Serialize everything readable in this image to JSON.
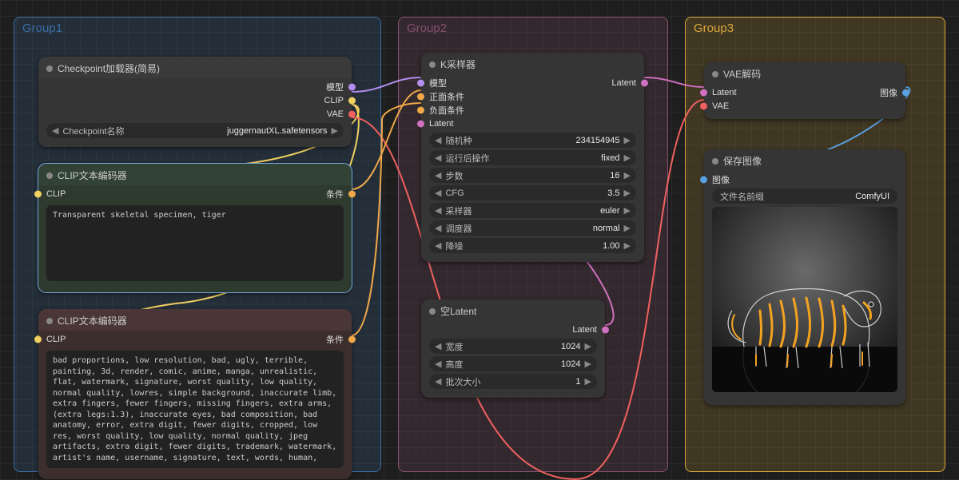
{
  "groups": {
    "g1": "Group1",
    "g2": "Group2",
    "g3": "Group3"
  },
  "checkpoint": {
    "title": "Checkpoint加载器(简易)",
    "out_model": "模型",
    "out_clip": "CLIP",
    "out_vae": "VAE",
    "widget_name": "Checkpoint名称",
    "widget_val": "juggernautXL.safetensors"
  },
  "pos": {
    "title": "CLIP文本编码器",
    "in_clip": "CLIP",
    "out_cond": "条件",
    "text": "Transparent skeletal specimen, tiger"
  },
  "neg": {
    "title": "CLIP文本编码器",
    "in_clip": "CLIP",
    "out_cond": "条件",
    "text": "bad proportions, low resolution, bad, ugly, terrible, painting, 3d, render, comic, anime, manga, unrealistic, flat, watermark, signature, worst quality, low quality, normal quality, lowres, simple background, inaccurate limb, extra fingers, fewer fingers, missing fingers, extra arms, (extra legs:1.3), inaccurate eyes, bad composition, bad anatomy, error, extra digit, fewer digits, cropped, low res, worst quality, low quality, normal quality, jpeg artifacts, extra digit, fewer digits, trademark, watermark, artist's name, username, signature, text, words, human,"
  },
  "ksampler": {
    "title": "K采样器",
    "in_model": "模型",
    "in_pos": "正面条件",
    "in_neg": "负面条件",
    "in_latent": "Latent",
    "out_latent": "Latent",
    "seed_name": "随机种",
    "seed_val": "234154945",
    "after_name": "运行后操作",
    "after_val": "fixed",
    "steps_name": "步数",
    "steps_val": "16",
    "cfg_name": "CFG",
    "cfg_val": "3.5",
    "sampler_name": "采样器",
    "sampler_val": "euler",
    "sched_name": "调度器",
    "sched_val": "normal",
    "denoise_name": "降噪",
    "denoise_val": "1.00"
  },
  "empty": {
    "title": "空Latent",
    "out_latent": "Latent",
    "w_name": "宽度",
    "w_val": "1024",
    "h_name": "高度",
    "h_val": "1024",
    "b_name": "批次大小",
    "b_val": "1"
  },
  "vaedec": {
    "title": "VAE解码",
    "in_latent": "Latent",
    "in_vae": "VAE",
    "out_image": "图像"
  },
  "save": {
    "title": "保存图像",
    "in_image": "图像",
    "prefix_name": "文件名前缀",
    "prefix_val": "ComfyUI"
  }
}
